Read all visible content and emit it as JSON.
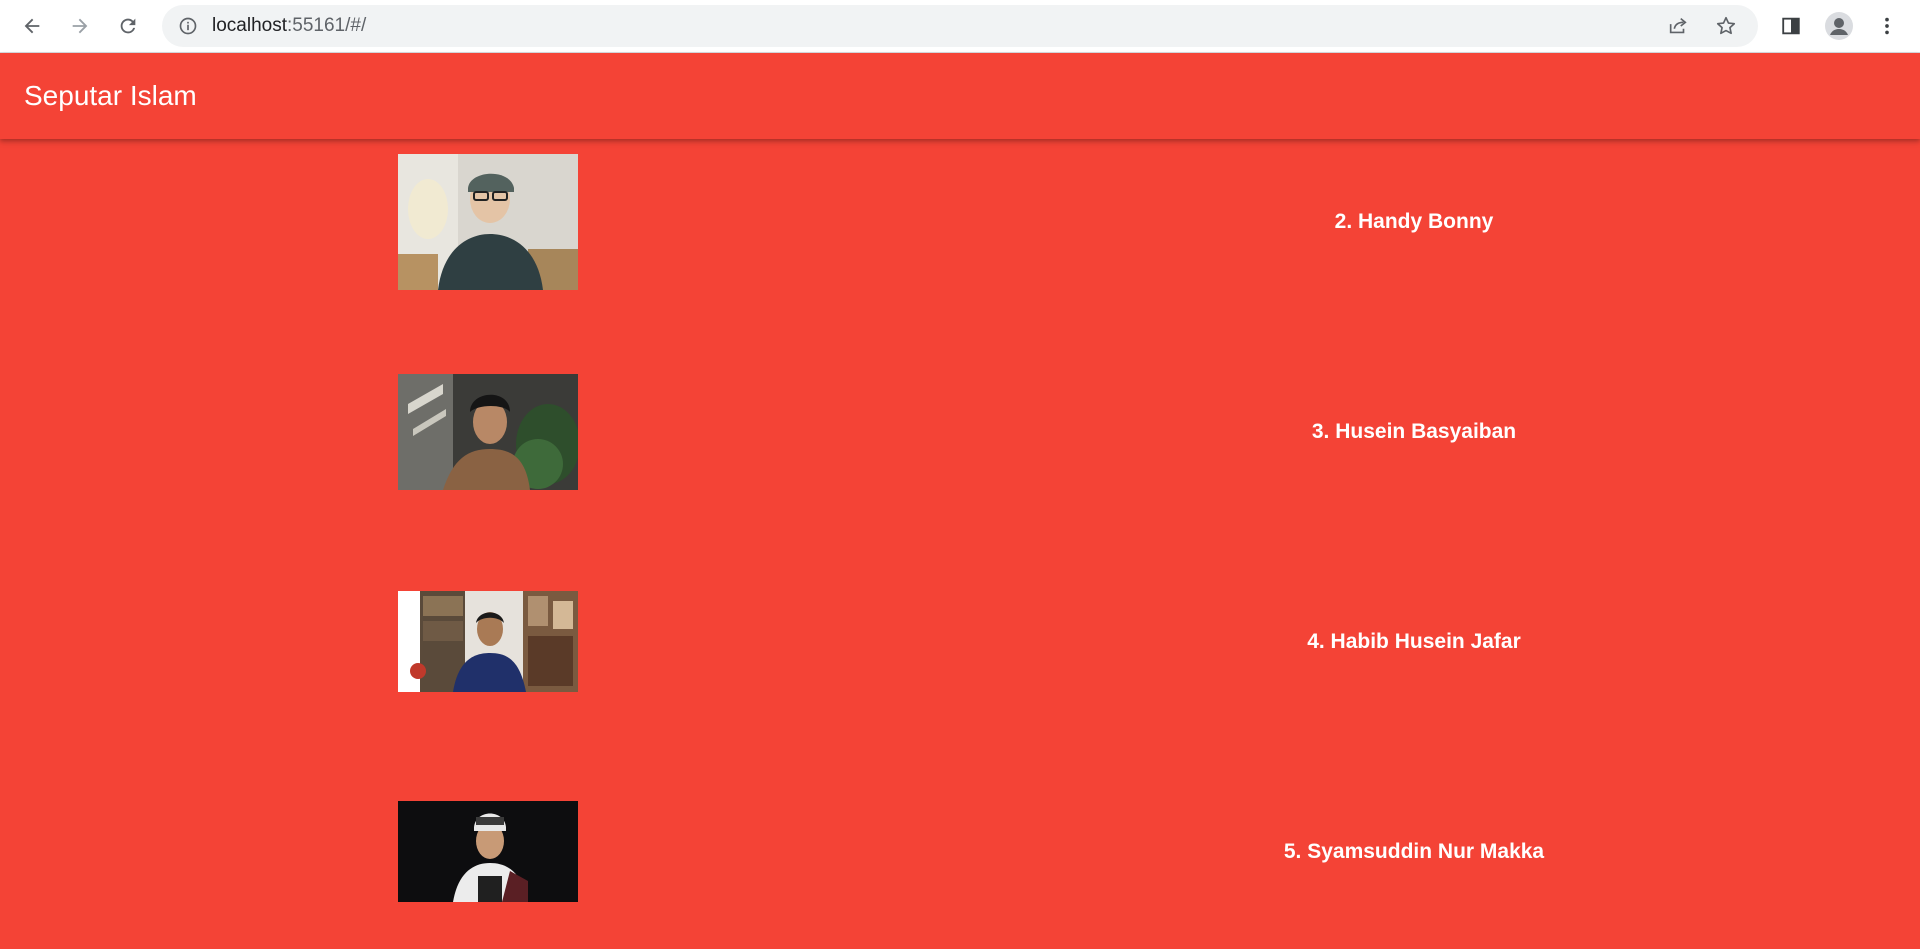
{
  "browser": {
    "url_host": "localhost",
    "url_rest": ":55161/#/",
    "icons": [
      "back-icon",
      "forward-icon",
      "reload-icon",
      "info-icon",
      "share-icon",
      "star-icon",
      "side-panel-icon",
      "profile-icon",
      "menu-icon"
    ]
  },
  "appbar": {
    "title": "Seputar Islam",
    "color": "#f44336"
  },
  "list": {
    "items": [
      {
        "name": "2. Handy Bonny"
      },
      {
        "name": "3. Husein Basyaiban"
      },
      {
        "name": "4. Habib Husein Jafar"
      },
      {
        "name": "5. Syamsuddin Nur Makka"
      }
    ]
  }
}
